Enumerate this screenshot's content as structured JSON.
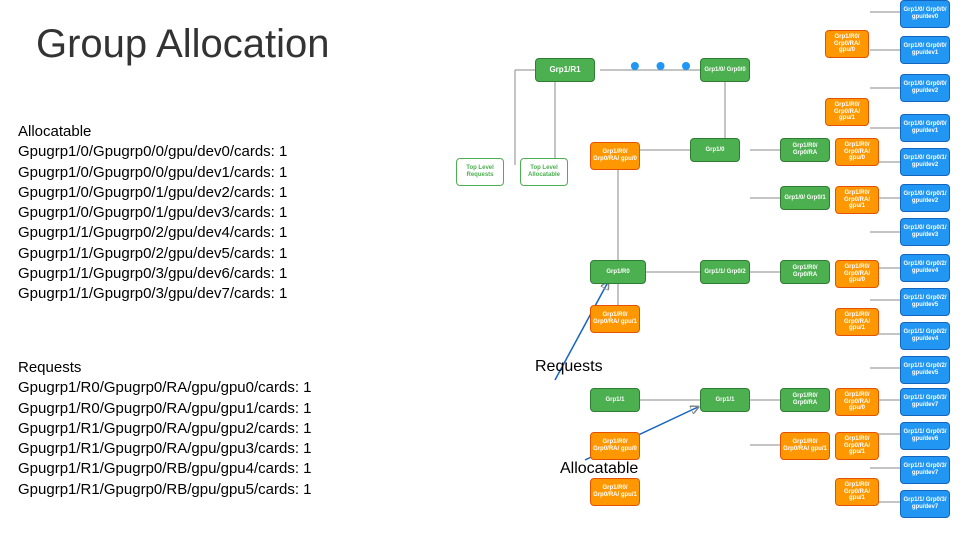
{
  "title": "Group Allocation",
  "allocatable": {
    "header": "Allocatable",
    "rows": [
      "Gpugrp1/0/Gpugrp0/0/gpu/dev0/cards: 1",
      "Gpugrp1/0/Gpugrp0/0/gpu/dev1/cards: 1",
      "Gpugrp1/0/Gpugrp0/1/gpu/dev2/cards: 1",
      "Gpugrp1/0/Gpugrp0/1/gpu/dev3/cards: 1",
      "Gpugrp1/1/Gpugrp0/2/gpu/dev4/cards: 1",
      "Gpugrp1/1/Gpugrp0/2/gpu/dev5/cards: 1",
      "Gpugrp1/1/Gpugrp0/3/gpu/dev6/cards: 1",
      "Gpugrp1/1/Gpugrp0/3/gpu/dev7/cards: 1"
    ]
  },
  "requests": {
    "header": "Requests",
    "rows": [
      "Gpugrp1/R0/Gpugrp0/RA/gpu/gpu0/cards: 1",
      "Gpugrp1/R0/Gpugrp0/RA/gpu/gpu1/cards: 1",
      "Gpugrp1/R1/Gpugrp0/RA/gpu/gpu2/cards: 1",
      "Gpugrp1/R1/Gpugrp0/RA/gpu/gpu3/cards: 1",
      "Gpugrp1/R1/Gpugrp0/RB/gpu/gpu4/cards: 1",
      "Gpugrp1/R1/Gpugrp0/RB/gpu/gpu5/cards: 1"
    ]
  },
  "annotations": {
    "requests": "Requests",
    "allocatable": "Allocatable"
  },
  "dots": "• • •",
  "nodes": {
    "top_level_requests": "Top Level Requests",
    "top_level_allocatable": "Top Level Allocatable",
    "r1": "Grp1/R1",
    "i0": "Grp1/0/ Grp0/0",
    "i1_0": "Grp1/0",
    "ra1": "Grp1/R0/ Grp0/RA",
    "i0_1": "Grp1/0/ Grp0/1",
    "r0": "Grp1/R0",
    "i1_1": "Grp1/1/ Grp0/2",
    "c1_1": "Grp1/1",
    "ra2": "Grp1/R0/ Grp0/RA",
    "ow1": "Grp1/R0/ Grp0/RA/ gpu/0",
    "ow2": "Grp1/R0/ Grp0/RA/ gpu/1",
    "ow3": "Grp1/R0/ Grp0/RA/ gpu/0",
    "ow4": "Grp1/R0/ Grp0/RA/ gpu/1",
    "ow5": "Grp1/R0/ Grp0/RA/ gpu/0",
    "ow6": "Grp1/R0/ Grp0/RA/ gpu/1",
    "b0": "Grp1/0/ Grp0/0/ gpu/dev0",
    "b1": "Grp1/0/ Grp0/0/ gpu/dev1",
    "b2": "Grp1/0/ Grp0/0/ gpu/dev2",
    "b3": "Grp1/0/ Grp0/0/ gpu/dev1",
    "b4": "Grp1/0/ Grp0/1/ gpu/dev2",
    "b5": "Grp1/0/ Grp0/1/ gpu/dev2",
    "b6": "Grp1/0/ Grp0/1/ gpu/dev3",
    "b7": "Grp1/0/ Grp0/2/ gpu/dev4",
    "b8": "Grp1/1/ Grp0/2/ gpu/dev5",
    "b9": "Grp1/1/ Grp0/2/ gpu/dev4",
    "b10": "Grp1/1/ Grp0/2/ gpu/dev5",
    "b11": "Grp1/1/ Grp0/3/ gpu/dev7",
    "b12": "Grp1/1/ Grp0/3/ gpu/dev6",
    "b13": "Grp1/1/ Grp0/3/ gpu/dev7",
    "b14": "Grp1/1/ Grp0/3/ gpu/dev7"
  }
}
